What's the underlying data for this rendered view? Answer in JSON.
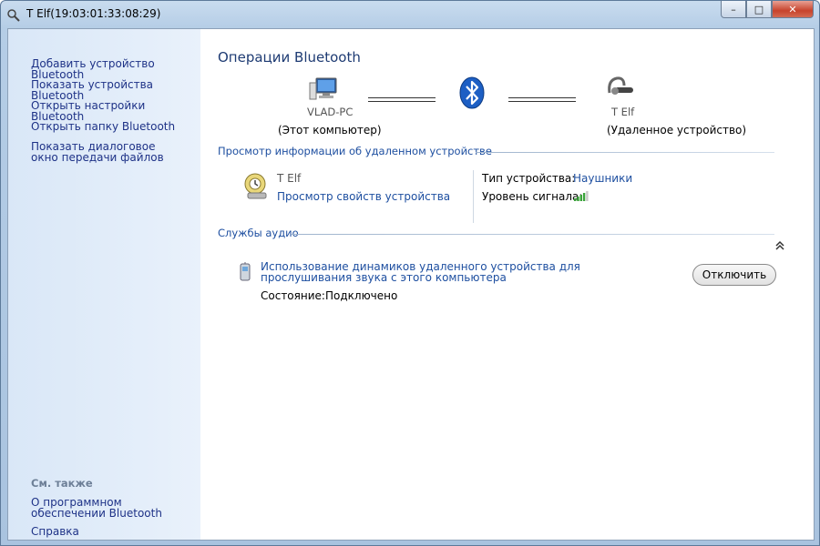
{
  "window": {
    "title": "T Elf(19:03:01:33:08:29)",
    "controls": {
      "minimize": "–",
      "maximize": "□",
      "close": "✕"
    }
  },
  "sidebar": {
    "tasks": [
      "Добавить устройство Bluetooth",
      "Показать устройства Bluetooth",
      "Открыть настройки Bluetooth",
      "Открыть папку Bluetooth",
      "Показать диалоговое окно передачи файлов"
    ],
    "see_also_heading": "См. также",
    "see_also": [
      "О программном обеспечении Bluetooth",
      "Справка"
    ]
  },
  "operations": {
    "heading": "Операции Bluetooth",
    "local_device": {
      "name": "VLAD-PC",
      "caption": "(Этот компьютер)",
      "icon": "computer-icon"
    },
    "remote_device": {
      "name": "T Elf",
      "caption": "(Удаленное устройство)",
      "icon": "headset-icon"
    },
    "center_icon": "bluetooth-icon"
  },
  "remote_info": {
    "section_title": "Просмотр информации об удаленном устройстве",
    "device_name": "T Elf",
    "properties_link": "Просмотр свойств устройства",
    "device_type_label": "Тип устройства:",
    "device_type_value": "Наушники",
    "signal_label": "Уровень сигнала:",
    "signal_bars": 4,
    "signal_max": 5
  },
  "audio_services": {
    "section_title": "Службы аудио",
    "service_text": "Использование динамиков удаленного устройства для прослушивания звука с этого компьютера",
    "status_label": "Состояние:",
    "status_value": "Подключено",
    "disconnect_label": "Отключить"
  },
  "colors": {
    "link": "#1e4fa0",
    "bluetooth": "#1d5fc4",
    "signal": "#3aa33a"
  }
}
